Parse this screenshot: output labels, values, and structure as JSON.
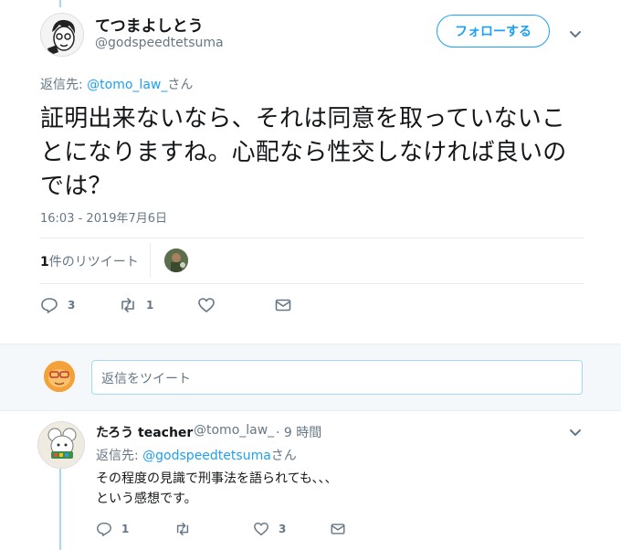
{
  "main_tweet": {
    "display_name": "てつまよしとう",
    "handle": "@godspeedtetsuma",
    "follow_label": "フォローする",
    "reply_prefix": "返信先: ",
    "reply_mention": "@tomo_law_",
    "reply_suffix": "さん",
    "text": "証明出来ないなら、それは同意を取っていないことになりますね。心配なら性交しなければ良いのでは？",
    "timestamp": "16:03 - 2019年7月6日",
    "retweet_count_num": "1",
    "retweet_count_label": "件のリツイート",
    "reply_count": "3",
    "retweet_count": "1",
    "like_count": ""
  },
  "reply_box": {
    "placeholder": "返信をツイート"
  },
  "reply_tweet": {
    "display_name": "たろう teacher",
    "handle": "@tomo_law_",
    "time": "· 9 時間",
    "reply_prefix": "返信先: ",
    "reply_mention": "@godspeedtetsuma",
    "reply_suffix": "さん",
    "text": "その程度の見識で刑事法を語られても、、、\nという感想です。",
    "reply_count": "1",
    "retweet_count": "",
    "like_count": "3"
  },
  "colors": {
    "accent": "#1da1f2",
    "secondary_text": "#657786",
    "thread_line": "#a4d9f5"
  }
}
